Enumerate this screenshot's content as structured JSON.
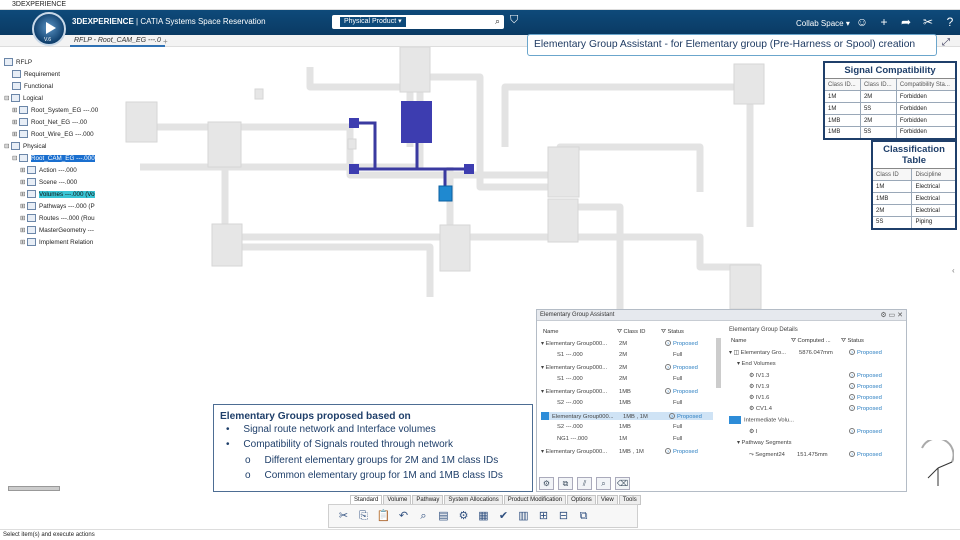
{
  "app": {
    "window_title": "3DEXPERIENCE",
    "brand_bold": "3DEXPERIENCE",
    "brand_rest": " | CATIA  Systems Space Reservation",
    "compass_version": "V.6"
  },
  "search": {
    "dropdown": "Physical Product",
    "placeholder": ""
  },
  "header": {
    "collab_space": "Collab Space"
  },
  "document": {
    "tab": "RFLP - Root_CAM_EG ---.0"
  },
  "banner": "Elementary Group Assistant - for Elementary group (Pre-Harness or Spool) creation",
  "tree": [
    {
      "label": "RFLP"
    },
    {
      "label": "Requirement"
    },
    {
      "label": "Functional"
    },
    {
      "label": "Logical"
    },
    {
      "label": "Root_System_EG ---.00"
    },
    {
      "label": "Root_Net_EG ---.00"
    },
    {
      "label": "Root_Wire_EG ---.000"
    },
    {
      "label": "Physical"
    },
    {
      "label": "Root_CAM_EG ---.000"
    },
    {
      "label": "Action ---.000"
    },
    {
      "label": "Scene ---.000"
    },
    {
      "label": "Volumes ---.000 (Vo"
    },
    {
      "label": "Pathways ---.000 (P"
    },
    {
      "label": "Routes ---.000 (Rou"
    },
    {
      "label": "MasterGeometry ---"
    },
    {
      "label": "Implement Relation"
    }
  ],
  "signal_compat": {
    "title": "Signal Compatibility",
    "headers": [
      "Class ID...",
      "Class ID...",
      "Compatibility Sta..."
    ],
    "rows": [
      [
        "1M",
        "2M",
        "Forbidden"
      ],
      [
        "1M",
        "5S",
        "Forbidden"
      ],
      [
        "1MB",
        "2M",
        "Forbidden"
      ],
      [
        "1MB",
        "5S",
        "Forbidden"
      ]
    ]
  },
  "class_table": {
    "title": "Classification Table",
    "headers": [
      "Class ID",
      "Discipline"
    ],
    "rows": [
      [
        "1M",
        "Electrical"
      ],
      [
        "1MB",
        "Electrical"
      ],
      [
        "2M",
        "Electrical"
      ],
      [
        "5S",
        "Piping"
      ]
    ]
  },
  "assistant": {
    "title": "Elementary Group Assistant",
    "left_headers": [
      "Name",
      "Class ID",
      "Status"
    ],
    "left_rows": [
      [
        "Elementary Group000...",
        "2M",
        "Proposed"
      ],
      [
        "S1 ---.000",
        "2M",
        "Full"
      ],
      [
        "Elementary Group000...",
        "2M",
        "Proposed"
      ],
      [
        "S1 ---.000",
        "2M",
        "Full"
      ],
      [
        "Elementary Group000...",
        "1MB",
        "Proposed"
      ],
      [
        "S2 ---.000",
        "1MB",
        "Full"
      ],
      [
        "Elementary Group000...",
        "1MB , 1M",
        "Proposed"
      ],
      [
        "S2 ---.000",
        "1MB",
        "Full"
      ],
      [
        "NG1 ---.000",
        "1M",
        "Full"
      ],
      [
        "Elementary Group000...",
        "1MB , 1M",
        "Proposed"
      ]
    ],
    "details_title": "Elementary Group Details",
    "right_headers": [
      "Name",
      "Computed ...",
      "Status"
    ],
    "right_rows": [
      [
        "Elementary Gro...",
        "5876.047mm",
        "Proposed"
      ],
      [
        "End Volumes",
        "",
        ""
      ],
      [
        "IV1.3",
        "",
        "Proposed"
      ],
      [
        "IV1.9",
        "",
        "Proposed"
      ],
      [
        "IV1.6",
        "",
        "Proposed"
      ],
      [
        "CV1.4",
        "",
        "Proposed"
      ],
      [
        "Intermediate Volu...",
        "",
        ""
      ],
      [
        "I",
        "",
        "Proposed"
      ],
      [
        "Pathway Segments",
        "",
        ""
      ],
      [
        "Segment24",
        "151.475mm",
        "Proposed"
      ]
    ]
  },
  "notes": {
    "title": "Elementary Groups proposed based on",
    "bullets": [
      "Signal route network and Interface volumes",
      "Compatibility of Signals routed through network"
    ],
    "sub_marker": "o",
    "sub": [
      "Different elementary groups for 2M and 1M class IDs",
      "Common elementary group for 1M and 1MB class IDs"
    ]
  },
  "action_tabs": [
    "Standard",
    "Volume",
    "Pathway",
    "System Allocations",
    "Product Modification",
    "Options",
    "View",
    "Tools"
  ],
  "status": "Select item(s) and execute actions"
}
